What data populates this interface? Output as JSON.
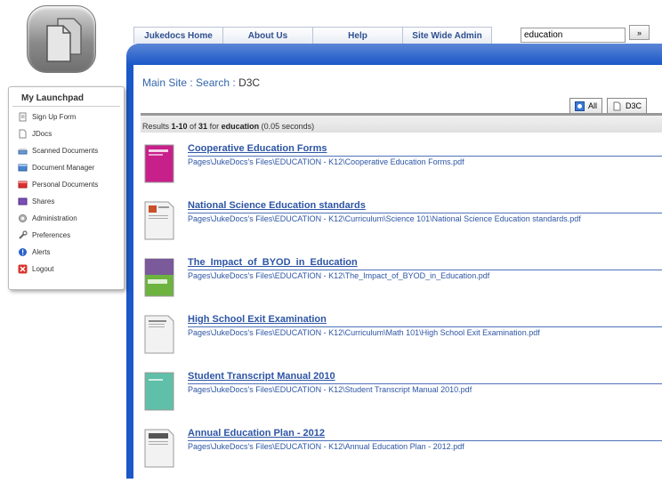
{
  "nav": {
    "tabs": [
      "Jukedocs Home",
      "About Us",
      "Help",
      "Site Wide Admin"
    ],
    "search_value": "education",
    "search_button": "»"
  },
  "sidebar": {
    "title": "My Launchpad",
    "items": [
      {
        "label": "Sign Up Form",
        "icon": "form-icon"
      },
      {
        "label": "JDocs",
        "icon": "document-icon"
      },
      {
        "label": "Scanned Documents",
        "icon": "scanner-icon"
      },
      {
        "label": "Document Manager",
        "icon": "document-manager-icon"
      },
      {
        "label": "Personal Documents",
        "icon": "personal-documents-icon"
      },
      {
        "label": "Shares",
        "icon": "shares-icon"
      },
      {
        "label": "Administration",
        "icon": "gear-icon"
      },
      {
        "label": "Preferences",
        "icon": "wrench-icon"
      },
      {
        "label": "Alerts",
        "icon": "alert-icon"
      },
      {
        "label": "Logout",
        "icon": "close-icon"
      }
    ]
  },
  "breadcrumb": {
    "main": "Main Site",
    "sep": " : ",
    "search": "Search",
    "current": "D3C"
  },
  "filters": {
    "all": "All",
    "d3c": "D3C"
  },
  "results_summary": {
    "prefix": "Results ",
    "range": "1-10",
    "of": " of ",
    "total": "31",
    "for": " for ",
    "query": "education",
    "time": " (0.05 seconds)"
  },
  "results": [
    {
      "title": "Cooperative Education Forms",
      "path": "Pages\\JukeDocs's Files\\EDUCATION - K12\\Cooperative Education Forms.pdf",
      "thumb_color": "#c8208a"
    },
    {
      "title": "National Science Education standards",
      "path": "Pages\\JukeDocs's Files\\EDUCATION - K12\\Curriculum\\Science 101\\National Science Education standards.pdf",
      "thumb_color": "#f2f2f2"
    },
    {
      "title": "The_Impact_of_BYOD_in_Education",
      "path": "Pages\\JukeDocs's Files\\EDUCATION - K12\\The_Impact_of_BYOD_in_Education.pdf",
      "thumb_color": "#6cb33f"
    },
    {
      "title": "High School Exit Examination",
      "path": "Pages\\JukeDocs's Files\\EDUCATION - K12\\Curriculum\\Math 101\\High School Exit Examination.pdf",
      "thumb_color": "#f2f2f2"
    },
    {
      "title": "Student Transcript Manual 2010",
      "path": "Pages\\JukeDocs's Files\\EDUCATION - K12\\Student Transcript Manual 2010.pdf",
      "thumb_color": "#5fbfa8"
    },
    {
      "title": "Annual Education Plan - 2012",
      "path": "Pages\\JukeDocs's Files\\EDUCATION - K12\\Annual Education Plan - 2012.pdf",
      "thumb_color": "#f2f2f2"
    }
  ]
}
